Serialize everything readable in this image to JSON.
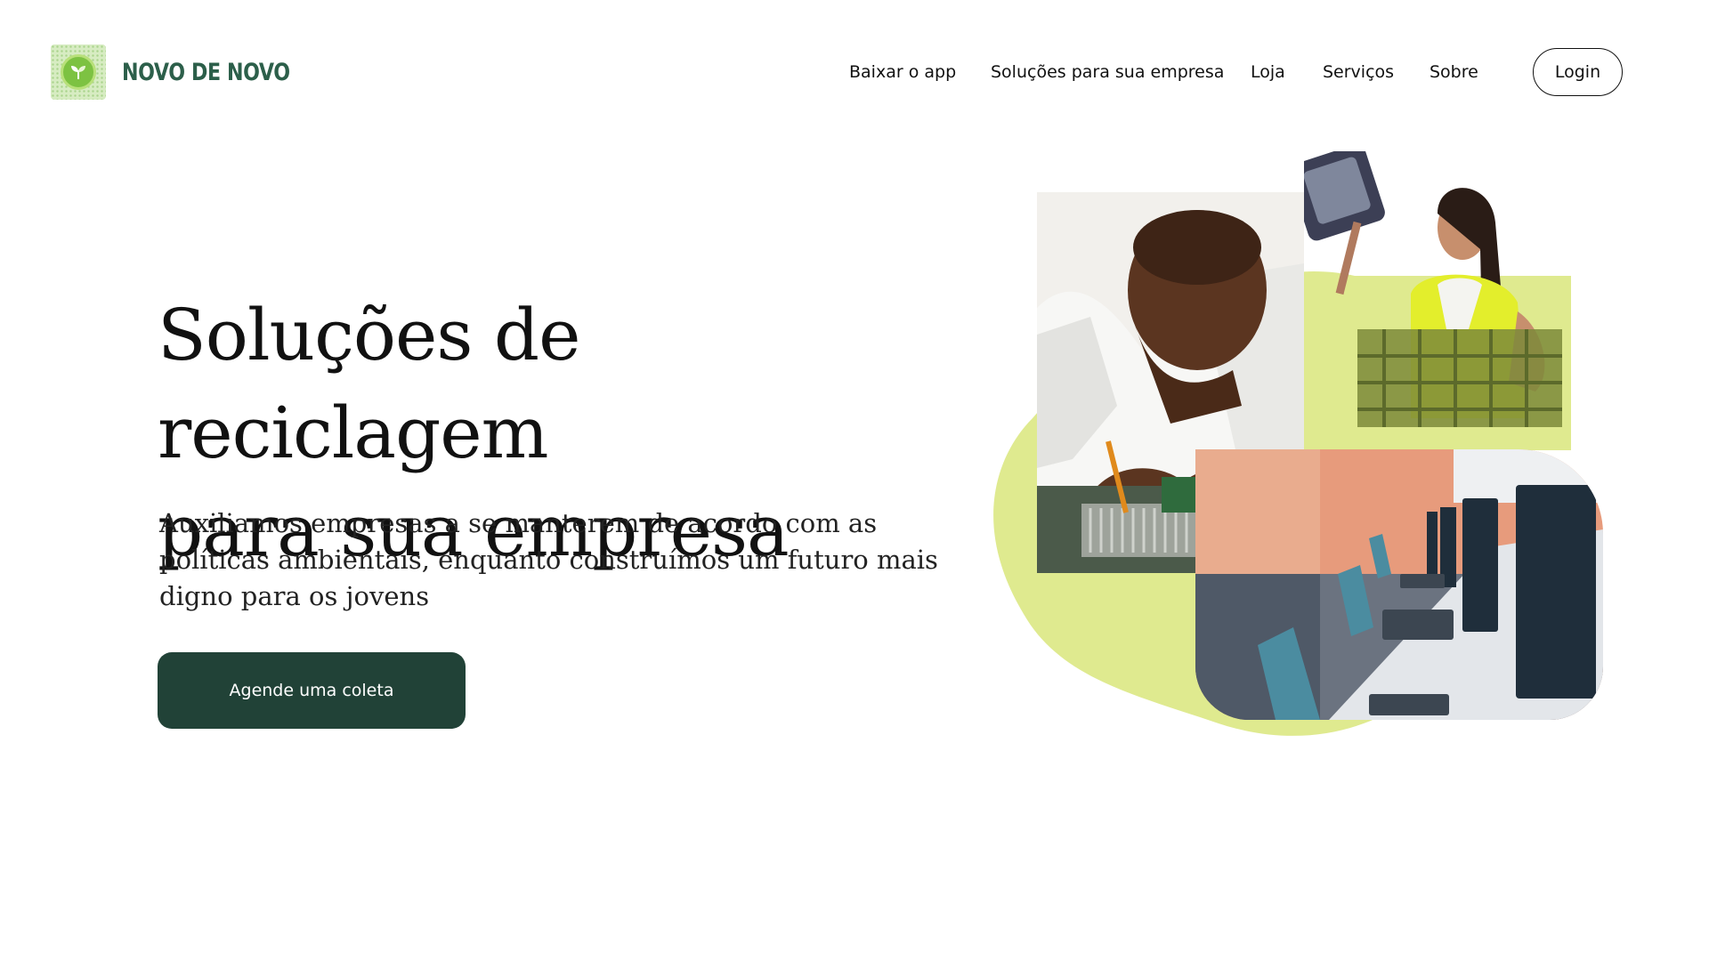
{
  "brand": {
    "name": "NOVO DE NOVO",
    "logo_icon": "recycle-leaf-icon",
    "color": "#2c5f4a"
  },
  "nav": {
    "items": [
      {
        "label": "Baixar o app"
      },
      {
        "label": "Soluções para sua empresa"
      },
      {
        "label": "Loja"
      },
      {
        "label": "Serviços"
      },
      {
        "label": "Sobre"
      }
    ],
    "login_label": "Login"
  },
  "hero": {
    "title_line1": "Soluções de reciclagem",
    "title_line2": "para sua empresa",
    "subtitle": "Auxiliamos empresas a se manterem de acordo com as políticas ambientais, enquanto construímos um futuro mais digno para os jovens",
    "cta_label": "Agende uma coleta",
    "cta_color": "#214237"
  },
  "collage": {
    "accent_color": "#dfea8f",
    "images": [
      "electronics-technician-photo",
      "recycling-worker-photo",
      "computer-lab-photo"
    ]
  }
}
